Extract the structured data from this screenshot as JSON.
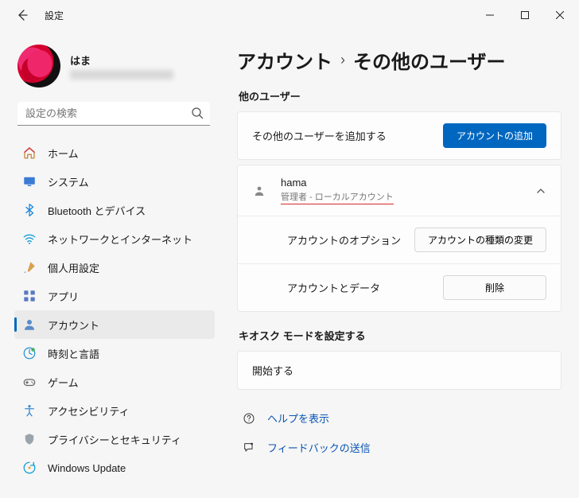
{
  "window": {
    "title": "設定"
  },
  "profile": {
    "name": "はま",
    "email": "████████████"
  },
  "search": {
    "placeholder": "設定の検索"
  },
  "sidebar": {
    "items": [
      {
        "label": "ホーム",
        "icon": "home",
        "selected": false
      },
      {
        "label": "システム",
        "icon": "system",
        "selected": false
      },
      {
        "label": "Bluetooth とデバイス",
        "icon": "bluetooth",
        "selected": false
      },
      {
        "label": "ネットワークとインターネット",
        "icon": "network",
        "selected": false
      },
      {
        "label": "個人用設定",
        "icon": "brush",
        "selected": false
      },
      {
        "label": "アプリ",
        "icon": "apps",
        "selected": false
      },
      {
        "label": "アカウント",
        "icon": "account",
        "selected": true
      },
      {
        "label": "時刻と言語",
        "icon": "time",
        "selected": false
      },
      {
        "label": "ゲーム",
        "icon": "game",
        "selected": false
      },
      {
        "label": "アクセシビリティ",
        "icon": "access",
        "selected": false
      },
      {
        "label": "プライバシーとセキュリティ",
        "icon": "privacy",
        "selected": false
      },
      {
        "label": "Windows Update",
        "icon": "update",
        "selected": false
      }
    ]
  },
  "breadcrumb": {
    "parent": "アカウント",
    "current": "その他のユーザー"
  },
  "sections": {
    "other_users_label": "他のユーザー",
    "add_other_user_text": "その他のユーザーを追加する",
    "add_account_button": "アカウントの追加",
    "user": {
      "name": "hama",
      "subtitle": "管理者 - ローカルアカウント",
      "account_options_label": "アカウントのオプション",
      "change_type_button": "アカウントの種類の変更",
      "account_data_label": "アカウントとデータ",
      "delete_button": "削除"
    },
    "kiosk_label": "キオスク モードを設定する",
    "kiosk_start": "開始する"
  },
  "footer": {
    "help": "ヘルプを表示",
    "feedback": "フィードバックの送信"
  }
}
